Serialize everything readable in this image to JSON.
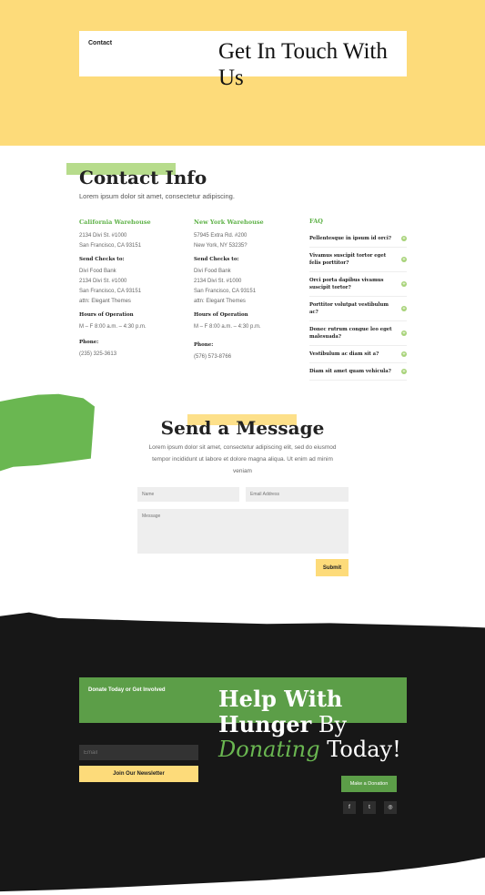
{
  "hero": {
    "tag": "Contact",
    "title": "Get In Touch With Us"
  },
  "contact_info": {
    "title": "Contact Info",
    "subtitle": "Lorem ipsum dolor sit amet, consectetur adipiscing.",
    "california": {
      "heading": "California Warehouse",
      "address1": "2134 Divi St. #1000",
      "address2": "San Francisco, CA 93151",
      "checks_label": "Send Checks to:",
      "checks1": "Divi Food Bank",
      "checks2": "2134 Divi St. #1000",
      "checks3": "San Francisco, CA 93151",
      "checks4": "attn: Elegant Themes",
      "hours_label": "Hours of Operation",
      "hours": "M – F 8:00 a.m. – 4:30 p.m.",
      "phone_label": "Phone:",
      "phone": "(235) 325-3613"
    },
    "new_york": {
      "heading": "New York Warehouse",
      "address1": "57945 Extra Rd. #200",
      "address2": "New York, NY 53235?",
      "checks_label": "Send Checks to:",
      "checks1": "Divi Food Bank",
      "checks2": "2134 Divi St. #1000",
      "checks3": "San Francisco, CA 93151",
      "checks4": "attn: Elegant Themes",
      "hours_label": "Hours of Operation",
      "hours": "M – F 8:00 a.m. – 4:30 p.m.",
      "phone_label": "Phone:",
      "phone": "(576) 573-8766"
    },
    "faq": {
      "title": "FAQ",
      "items": [
        "Pellentesque in ipsum id orci?",
        "Vivamus suscipit tortor eget felis porttitor?",
        "Orci porta dapibus vivamus suscipit tortor?",
        "Porttitor volutpat vestibulum ac?",
        "Donec rutrum congue leo eget malesuada?",
        "Vestibulum ac diam sit a?",
        "Diam sit amet quam vehicula?"
      ]
    }
  },
  "send_message": {
    "title": "Send a Message",
    "text": "Lorem ipsum dolor sit amet, consectetur adipiscing elit, sed do eiusmod tempor incididunt ut labore et dolore magna aliqua. Ut enim ad minim veniam",
    "name_placeholder": "Name",
    "email_placeholder": "Email Address",
    "message_placeholder": "Message",
    "submit_label": "Submit"
  },
  "footer": {
    "donate_tag": "Donate Today or Get Involved",
    "title_part1": "Help With",
    "title_part2": "Hunger",
    "title_part3": "By",
    "title_part4": "Donating",
    "title_part5": "Today!",
    "email_placeholder": "Email",
    "newsletter_label": "Join Our Newsletter",
    "donation_label": "Make a Donation",
    "social": {
      "facebook": "f",
      "twitter": "t",
      "instagram": "◎"
    }
  },
  "colors": {
    "yellow": "#fddb7a",
    "green": "#5c9e48",
    "dark": "#171717"
  }
}
